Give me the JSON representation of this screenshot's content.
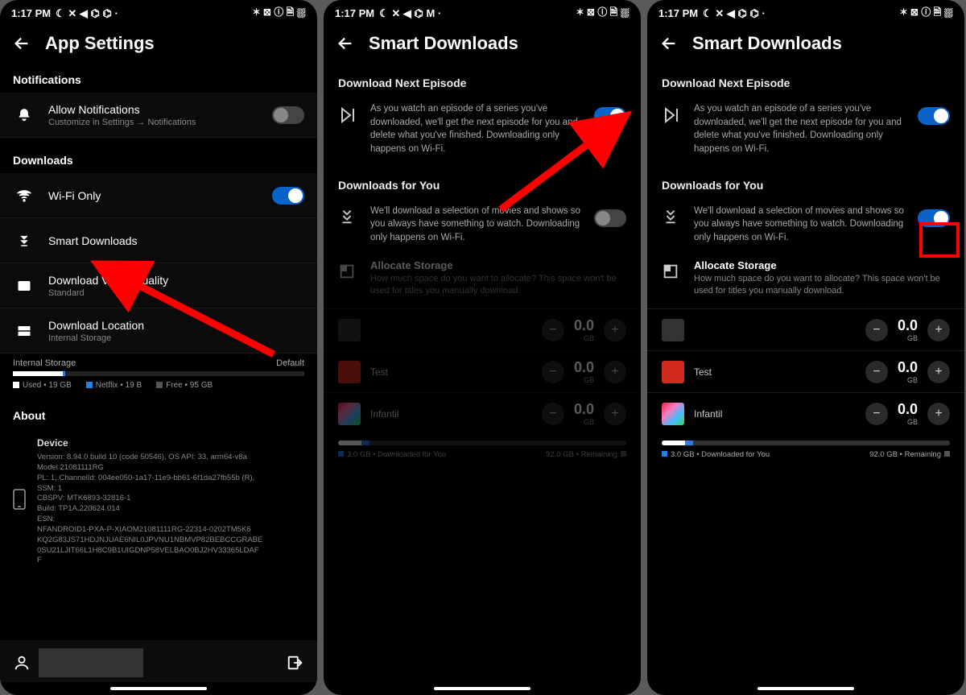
{
  "status": {
    "time": "1:17 PM",
    "left_icons": "☾ ✕ ◀ ⌬ ⌬ ·",
    "left_icons_alt": "☾ ✕ ◀ ⌬ M ·",
    "right_icons": "✶ ⊠ ⓘ 🗎 ⛆"
  },
  "screen1": {
    "title": "App Settings",
    "sections": {
      "notifications": {
        "title": "Notifications",
        "row": {
          "label": "Allow Notifications",
          "sub": "Customize in Settings → Notifications",
          "on": false
        }
      },
      "downloads": {
        "title": "Downloads",
        "wifi": {
          "label": "Wi-Fi Only",
          "on": true
        },
        "smart": {
          "label": "Smart Downloads"
        },
        "quality": {
          "label": "Download Video Quality",
          "sub": "Standard"
        },
        "location": {
          "label": "Download Location",
          "sub": "Internal Storage"
        }
      },
      "storage": {
        "label": "Internal Storage",
        "right": "Default",
        "used": "Used • 19 GB",
        "netflix": "Netflix • 19 B",
        "free": "Free • 95 GB"
      },
      "about": {
        "title": "About",
        "device_label": "Device",
        "lines": "Version: 8.94.0 build 10 (code 50546), OS API: 33, arm64-v8a\nModel 21081111RG\nPL: 1, ChannelId: 004ee050-1a17-11e9-bb61-6f1da27fb55b (R),\nSSM: 1\nCBSPV: MTK6893-32816-1\nBuild: TP1A.220624.014\nESN:\nNFANDROID1-PXA-P-XIAOM21081111RG-22314-0202TM5K6\nKQ2G83JS71HDJNJUAE6NIL0JPVNU1NBMVP82BEBCCGRABE\n0SU21LJIT66L1H8C9B1UIGDNP58VELBAO0BJ2HV33365LDAF\nF"
      }
    }
  },
  "screen2": {
    "title": "Smart Downloads",
    "dne": {
      "title": "Download Next Episode",
      "text": "As you watch an episode of a series you've downloaded, we'll get the next episode for you and delete what you've finished. Downloading only happens on Wi-Fi.",
      "on": true
    },
    "dfy": {
      "title": "Downloads for You",
      "text": "We'll download a selection of movies and shows so you always have something to watch. Downloading only happens on Wi-Fi.",
      "on": false
    },
    "allocate": {
      "heading": "Allocate Storage",
      "sub": "How much space do you want to allocate? This space won't be used for titles you manually download."
    },
    "profiles": [
      {
        "name": "",
        "val": "0.0",
        "unit": "GB"
      },
      {
        "name": "Test",
        "val": "0.0",
        "unit": "GB"
      },
      {
        "name": "Infantil",
        "val": "0.0",
        "unit": "GB"
      }
    ],
    "bar": {
      "left": "3.0 GB • Downloaded for You",
      "right": "92.0 GB • Remaining"
    }
  },
  "screen3": {
    "title": "Smart Downloads",
    "dne": {
      "title": "Download Next Episode",
      "text": "As you watch an episode of a series you've downloaded, we'll get the next episode for you and delete what you've finished. Downloading only happens on Wi-Fi.",
      "on": true
    },
    "dfy": {
      "title": "Downloads for You",
      "text": "We'll download a selection of movies and shows so you always have something to watch. Downloading only happens on Wi-Fi.",
      "on": true
    },
    "allocate": {
      "heading": "Allocate Storage",
      "sub": "How much space do you want to allocate? This space won't be used for titles you manually download."
    },
    "profiles": [
      {
        "name": "",
        "val": "0.0",
        "unit": "GB"
      },
      {
        "name": "Test",
        "val": "0.0",
        "unit": "GB"
      },
      {
        "name": "Infantil",
        "val": "0.0",
        "unit": "GB"
      }
    ],
    "bar": {
      "left": "3.0 GB • Downloaded for You",
      "right": "92.0 GB • Remaining"
    }
  }
}
